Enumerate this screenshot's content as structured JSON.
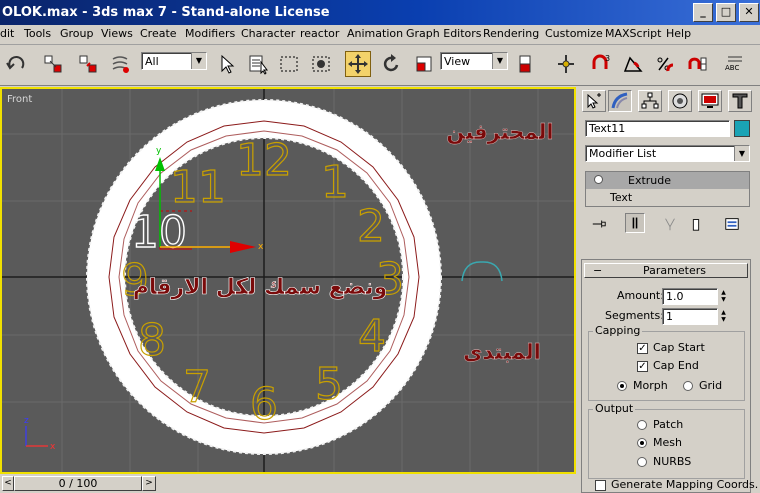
{
  "window": {
    "title": "OLOK.max - 3ds max 7  - Stand-alone License",
    "buttons": [
      "_",
      "□",
      "✕"
    ]
  },
  "menu": [
    "dit",
    "Tools",
    "Group",
    "Views",
    "Create",
    "Modifiers",
    "Character",
    "reactor",
    "Animation",
    "Graph Editors",
    "Rendering",
    "Customize",
    "MAXScript",
    "Help"
  ],
  "toolbar": {
    "selection_filter": "All",
    "reference_coord": "View",
    "icons": [
      "undo-icon",
      "select-link-icon",
      "unlink-icon",
      "bind-spacewarp-icon",
      "select-object-icon",
      "select-by-name-icon",
      "rectangular-selection-icon",
      "window-crossing-icon",
      "move-icon",
      "rotate-icon",
      "scale-icon",
      "pivot-center-icon",
      "manipulate-icon",
      "snap-icon",
      "angle-snap-icon",
      "percent-snap-icon",
      "spinner-snap-icon",
      "named-selection-icon"
    ]
  },
  "viewport": {
    "label": "Front",
    "clock_numbers": [
      "12",
      "1",
      "2",
      "3",
      "4",
      "5",
      "6",
      "7",
      "8",
      "9",
      "10",
      "11"
    ],
    "text_top_right": "المحترفين",
    "text_center": "ونضع سمك لكل الارقام",
    "text_bottom_right": "المبتدى",
    "colors": {
      "background": "#5a5a5a",
      "border": "#f0e000",
      "numbers": "#c8a000",
      "selected_number": "#ffffff",
      "arabic_text": "#7a0a0a",
      "ring": "#ffffff",
      "ring_outline": "#8b1a1a",
      "gizmo_x": "#ff0000",
      "gizmo_y": "#00c000",
      "gizmo_z": "#0000ff"
    }
  },
  "timeline": {
    "frame_readout": "0 / 100",
    "prev": "<",
    "next": ">"
  },
  "panel": {
    "tabs": [
      "create-tab-icon",
      "modify-tab-icon",
      "hierarchy-tab-icon",
      "motion-tab-icon",
      "display-tab-icon",
      "utilities-tab-icon"
    ],
    "object_name": "Text11",
    "object_color": "#1aa3b5",
    "modifier_list": "Modifier List",
    "stack": [
      "Extrude",
      "Text"
    ],
    "parameters": {
      "title": "Parameters",
      "collapse": "−",
      "amount_label": "Amount:",
      "amount_value": "1.0",
      "segments_label": "Segments:",
      "segments_value": "1",
      "capping_label": "Capping",
      "cap_start": "Cap Start",
      "cap_end": "Cap End",
      "morph": "Morph",
      "grid": "Grid",
      "output_label": "Output",
      "patch": "Patch",
      "mesh": "Mesh",
      "nurbs": "NURBS",
      "gen_mapping": "Generate Mapping Coords."
    }
  }
}
